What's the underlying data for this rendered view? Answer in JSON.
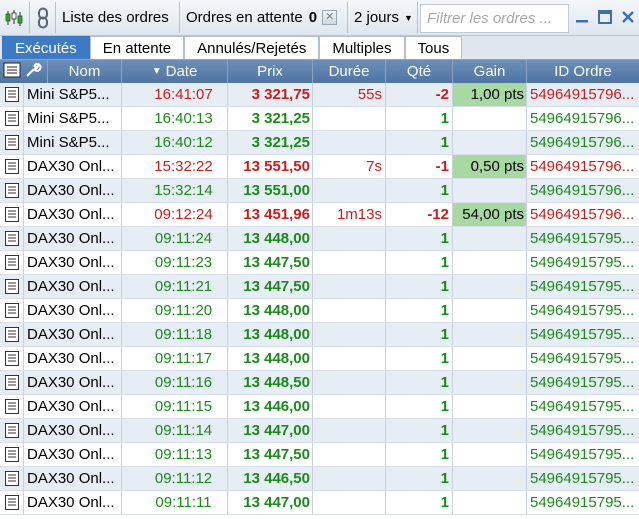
{
  "toolbar": {
    "list_label": "Liste des ordres",
    "pending_label": "Ordres en attente",
    "pending_count": "0",
    "period_label": "2 jours",
    "filter_placeholder": "Filtrer les ordres ..."
  },
  "tabs": [
    {
      "label": "Exécutés",
      "active": true
    },
    {
      "label": "En attente",
      "active": false
    },
    {
      "label": "Annulés/Rejetés",
      "active": false
    },
    {
      "label": "Multiples",
      "active": false
    },
    {
      "label": "Tous",
      "active": false
    }
  ],
  "columns": {
    "nom": "Nom",
    "date": "Date",
    "prix": "Prix",
    "duree": "Durée",
    "qte": "Qté",
    "gain": "Gain",
    "id": "ID Ordre"
  },
  "colors": {
    "buy": "#1d8a1d",
    "sell": "#c81e1e",
    "gain_bg": "#a9d9a2",
    "active_tab": "#3d7ac4"
  },
  "rows": [
    {
      "name": "Mini S&P5...",
      "date": "16:41:07",
      "price": "3 321,75",
      "duration": "55s",
      "qty": "-2",
      "gain": "1,00 pts",
      "id": "54964915796...",
      "side": "sell"
    },
    {
      "name": "Mini S&P5...",
      "date": "16:40:13",
      "price": "3 321,25",
      "duration": "",
      "qty": "1",
      "gain": "",
      "id": "54964915796...",
      "side": "buy"
    },
    {
      "name": "Mini S&P5...",
      "date": "16:40:12",
      "price": "3 321,25",
      "duration": "",
      "qty": "1",
      "gain": "",
      "id": "54964915796...",
      "side": "buy"
    },
    {
      "name": "DAX30 Onl...",
      "date": "15:32:22",
      "price": "13 551,50",
      "duration": "7s",
      "qty": "-1",
      "gain": "0,50 pts",
      "id": "54964915796...",
      "side": "sell"
    },
    {
      "name": "DAX30 Onl...",
      "date": "15:32:14",
      "price": "13 551,00",
      "duration": "",
      "qty": "1",
      "gain": "",
      "id": "54964915796...",
      "side": "buy"
    },
    {
      "name": "DAX30 Onl...",
      "date": "09:12:24",
      "price": "13 451,96",
      "duration": "1m13s",
      "qty": "-12",
      "gain": "54,00 pts",
      "id": "54964915796...",
      "side": "sell"
    },
    {
      "name": "DAX30 Onl...",
      "date": "09:11:24",
      "price": "13 448,00",
      "duration": "",
      "qty": "1",
      "gain": "",
      "id": "54964915795...",
      "side": "buy"
    },
    {
      "name": "DAX30 Onl...",
      "date": "09:11:23",
      "price": "13 447,50",
      "duration": "",
      "qty": "1",
      "gain": "",
      "id": "54964915795...",
      "side": "buy"
    },
    {
      "name": "DAX30 Onl...",
      "date": "09:11:21",
      "price": "13 447,50",
      "duration": "",
      "qty": "1",
      "gain": "",
      "id": "54964915795...",
      "side": "buy"
    },
    {
      "name": "DAX30 Onl...",
      "date": "09:11:20",
      "price": "13 448,00",
      "duration": "",
      "qty": "1",
      "gain": "",
      "id": "54964915795...",
      "side": "buy"
    },
    {
      "name": "DAX30 Onl...",
      "date": "09:11:18",
      "price": "13 448,00",
      "duration": "",
      "qty": "1",
      "gain": "",
      "id": "54964915795...",
      "side": "buy"
    },
    {
      "name": "DAX30 Onl...",
      "date": "09:11:17",
      "price": "13 448,00",
      "duration": "",
      "qty": "1",
      "gain": "",
      "id": "54964915795...",
      "side": "buy"
    },
    {
      "name": "DAX30 Onl...",
      "date": "09:11:16",
      "price": "13 448,50",
      "duration": "",
      "qty": "1",
      "gain": "",
      "id": "54964915795...",
      "side": "buy"
    },
    {
      "name": "DAX30 Onl...",
      "date": "09:11:15",
      "price": "13 446,00",
      "duration": "",
      "qty": "1",
      "gain": "",
      "id": "54964915795...",
      "side": "buy"
    },
    {
      "name": "DAX30 Onl...",
      "date": "09:11:14",
      "price": "13 447,00",
      "duration": "",
      "qty": "1",
      "gain": "",
      "id": "54964915795...",
      "side": "buy"
    },
    {
      "name": "DAX30 Onl...",
      "date": "09:11:13",
      "price": "13 447,50",
      "duration": "",
      "qty": "1",
      "gain": "",
      "id": "54964915795...",
      "side": "buy"
    },
    {
      "name": "DAX30 Onl...",
      "date": "09:11:12",
      "price": "13 446,50",
      "duration": "",
      "qty": "1",
      "gain": "",
      "id": "54964915795...",
      "side": "buy"
    },
    {
      "name": "DAX30 Onl...",
      "date": "09:11:11",
      "price": "13 447,00",
      "duration": "",
      "qty": "1",
      "gain": "",
      "id": "54964915795...",
      "side": "buy"
    }
  ]
}
